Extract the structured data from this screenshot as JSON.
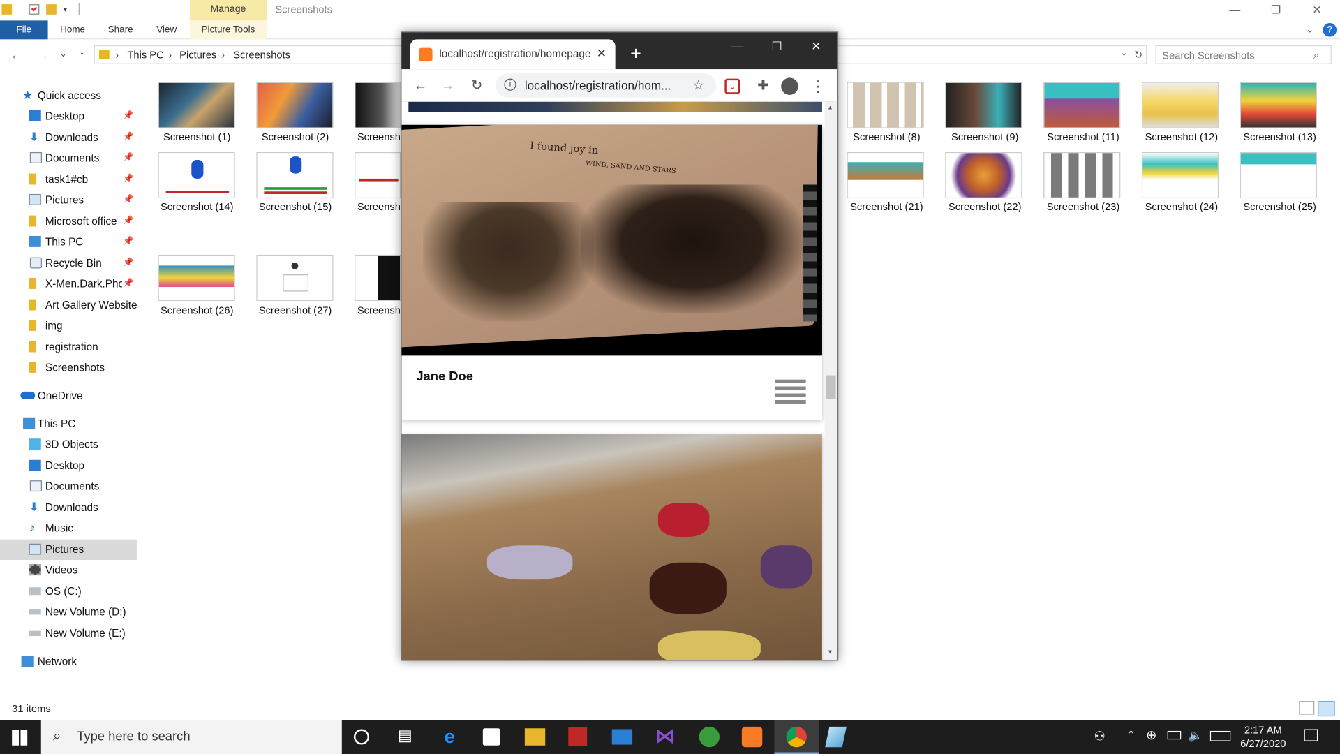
{
  "explorer": {
    "title": "Screenshots",
    "manage_tab": "Manage",
    "picture_tools_tab": "Picture Tools",
    "ribbon_tabs": {
      "file": "File",
      "home": "Home",
      "share": "Share",
      "view": "View"
    },
    "breadcrumb": [
      "This PC",
      "Pictures",
      "Screenshots"
    ],
    "search_placeholder": "Search Screenshots",
    "status": "31 items",
    "nav": {
      "quick_access": "Quick access",
      "items": {
        "qa_desktop": "Desktop",
        "qa_downloads": "Downloads",
        "qa_documents": "Documents",
        "qa_task1": "task1#cb",
        "qa_pictures": "Pictures",
        "qa_msoffice": "Microsoft office",
        "qa_thispc": "This PC",
        "qa_recycle": "Recycle Bin",
        "qa_xmen": "X-Men.Dark.Phoe",
        "qa_artgallery": "Art Gallery Website",
        "qa_img": "img",
        "qa_registration": "registration",
        "qa_screenshots": "Screenshots",
        "onedrive": "OneDrive",
        "thispc": "This PC",
        "pc_3d": "3D Objects",
        "pc_desktop": "Desktop",
        "pc_documents": "Documents",
        "pc_downloads": "Downloads",
        "pc_music": "Music",
        "pc_pictures": "Pictures",
        "pc_videos": "Videos",
        "pc_osc": "OS (C:)",
        "pc_vold": "New Volume (D:)",
        "pc_vole": "New Volume (E:)",
        "network": "Network"
      }
    },
    "files": {
      "f1": "Screenshot (1)",
      "f2": "Screenshot (2)",
      "f3": "Screensh",
      "f8": "Screenshot (8)",
      "f9": "Screenshot (9)",
      "f11": "Screenshot (11)",
      "f12": "Screenshot (12)",
      "f13": "Screenshot (13)",
      "f14": "Screenshot (14)",
      "f15": "Screenshot (15)",
      "f16": "Screensh",
      "f21": "Screenshot (21)",
      "f22": "Screenshot (22)",
      "f23": "Screenshot (23)",
      "f24": "Screenshot (24)",
      "f25": "Screenshot (25)",
      "f26": "Screenshot (26)",
      "f27": "Screenshot (27)",
      "f28": "Screensh"
    }
  },
  "browser": {
    "tab_title": "localhost/registration/homepage",
    "url": "localhost/registration/hom...",
    "card1": {
      "sketch_line1": "I found joy in",
      "sketch_line2": "WIND, SAND AND STARS",
      "artist": "Jane Doe"
    }
  },
  "taskbar": {
    "search_placeholder": "Type here to search",
    "time": "2:17 AM",
    "date": "6/27/2020"
  },
  "colors": {
    "accent": "#1f5fa6",
    "chrome_frame": "#2b2b2b",
    "manage_tab": "#f7e9a6"
  }
}
